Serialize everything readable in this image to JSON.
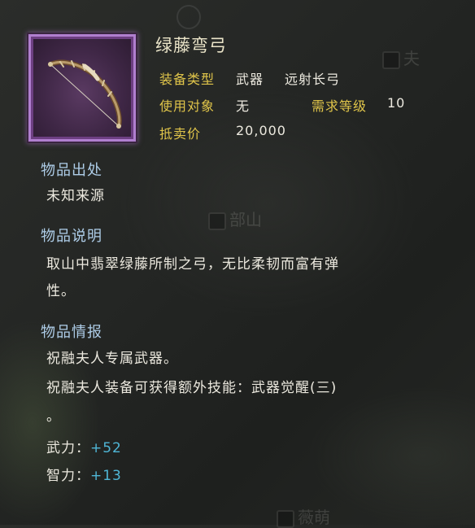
{
  "background": {
    "map_labels": [
      "夫",
      "部山",
      "薇萌"
    ]
  },
  "item": {
    "name": "绿藤弯弓",
    "icon": "bow-icon",
    "rarity_color": "#b07fcf"
  },
  "stats": {
    "equip_type_label": "装备类型",
    "equip_type_value": "武器",
    "equip_subtype_value": "远射长弓",
    "user_label": "使用对象",
    "user_value": "无",
    "level_req_label": "需求等级",
    "level_req_value": "10",
    "sell_price_label": "抵卖价",
    "sell_price_value": "20,000"
  },
  "sections": {
    "origin": {
      "title": "物品出处",
      "text": "未知来源"
    },
    "description": {
      "title": "物品说明",
      "line1": "取山中翡翠绿藤所制之弓，无比柔韧而富有弹",
      "line2": "性。"
    },
    "info": {
      "title": "物品情报",
      "line1": "祝融夫人专属武器。",
      "line2": "祝融夫人装备可获得额外技能：武器觉醒(三)",
      "line3": "。"
    }
  },
  "attributes": [
    {
      "label": "武力：",
      "value": "+52"
    },
    {
      "label": "智力：",
      "value": "+13"
    }
  ],
  "colors": {
    "label_gold": "#e0c54a",
    "section_blue": "#aecde8",
    "bonus_cyan": "#4fb6d6",
    "text_white": "#ece9df"
  }
}
